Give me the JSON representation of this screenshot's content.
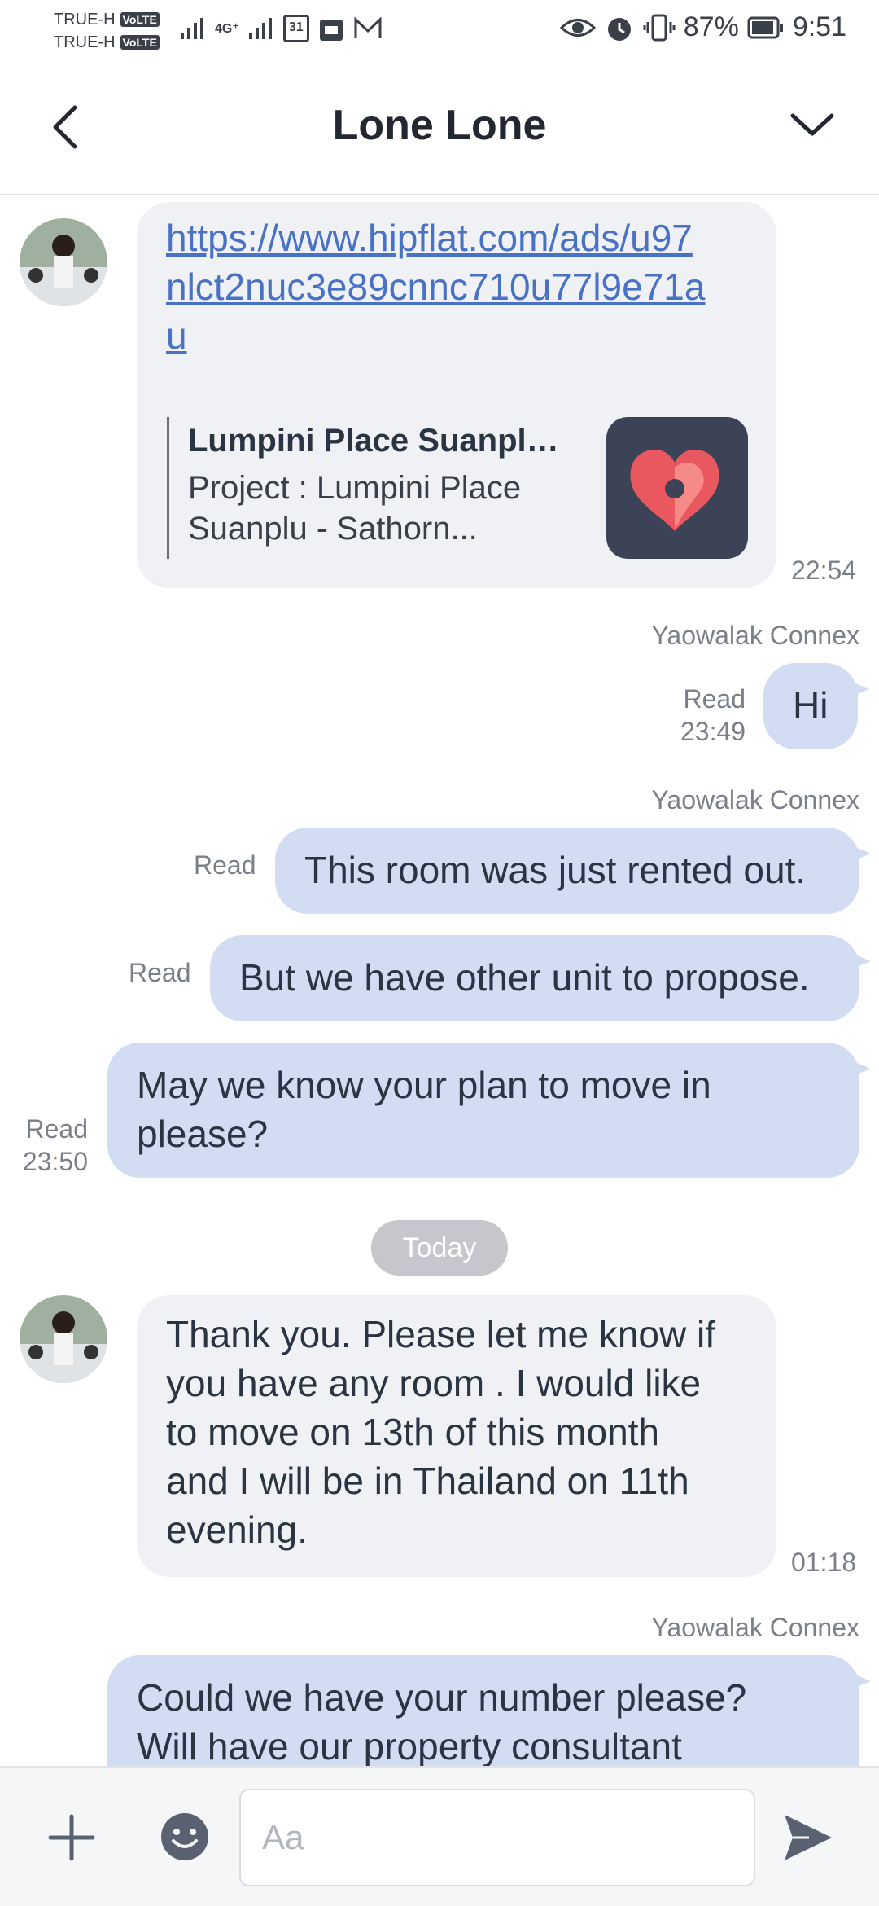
{
  "status_bar": {
    "carrier_1": "TRUE-H",
    "carrier_2": "TRUE-H",
    "volte": "VoLTE",
    "network": "4G⁺",
    "calendar_day": "31",
    "battery": "87%",
    "time": "9:51"
  },
  "header": {
    "title": "Lone Lone"
  },
  "messages": {
    "link": {
      "url_line1": "https://www.hipflat.com/ads/u97",
      "url_line2": "nlct2nuc3e89cnnc710u77l9e71a",
      "url_line3": "u",
      "preview_title": "Lumpini Place Suanplu ...",
      "preview_desc_line1": "Project : Lumpini Place",
      "preview_desc_line2": "Suanplu - Sathorn...",
      "time": "22:54"
    },
    "m1": {
      "sender": "Yaowalak Connex",
      "text": "Hi",
      "status": "Read",
      "time": "23:49"
    },
    "m2": {
      "sender": "Yaowalak Connex",
      "text": "This room was just rented out.",
      "status": "Read"
    },
    "m3": {
      "text": "But we have other unit to propose.",
      "status": "Read"
    },
    "m4": {
      "line1": "May we know your plan to move in",
      "line2": "please?",
      "status": "Read",
      "time": "23:50"
    },
    "date_divider": "Today",
    "m5": {
      "line1": "Thank you. Please let me know if",
      "line2": "you have any room . I would like",
      "line3": "to move on 13th of this month",
      "line4": "and I will be in Thailand on 11th",
      "line5": "evening.",
      "time": "01:18"
    },
    "m6": {
      "sender": "Yaowalak Connex",
      "line1": "Could we have your number please?",
      "line2": "Will have our property consultant"
    }
  },
  "composer": {
    "placeholder": "Aa"
  },
  "colors": {
    "incoming_bubble": "#f0f1f4",
    "outgoing_bubble": "#d2dcf3",
    "link": "#4a72c4",
    "date_pill": "#c5c7cc"
  },
  "icons": [
    "back-arrow-icon",
    "chevron-down-icon",
    "plus-icon",
    "emoji-icon",
    "send-icon"
  ]
}
